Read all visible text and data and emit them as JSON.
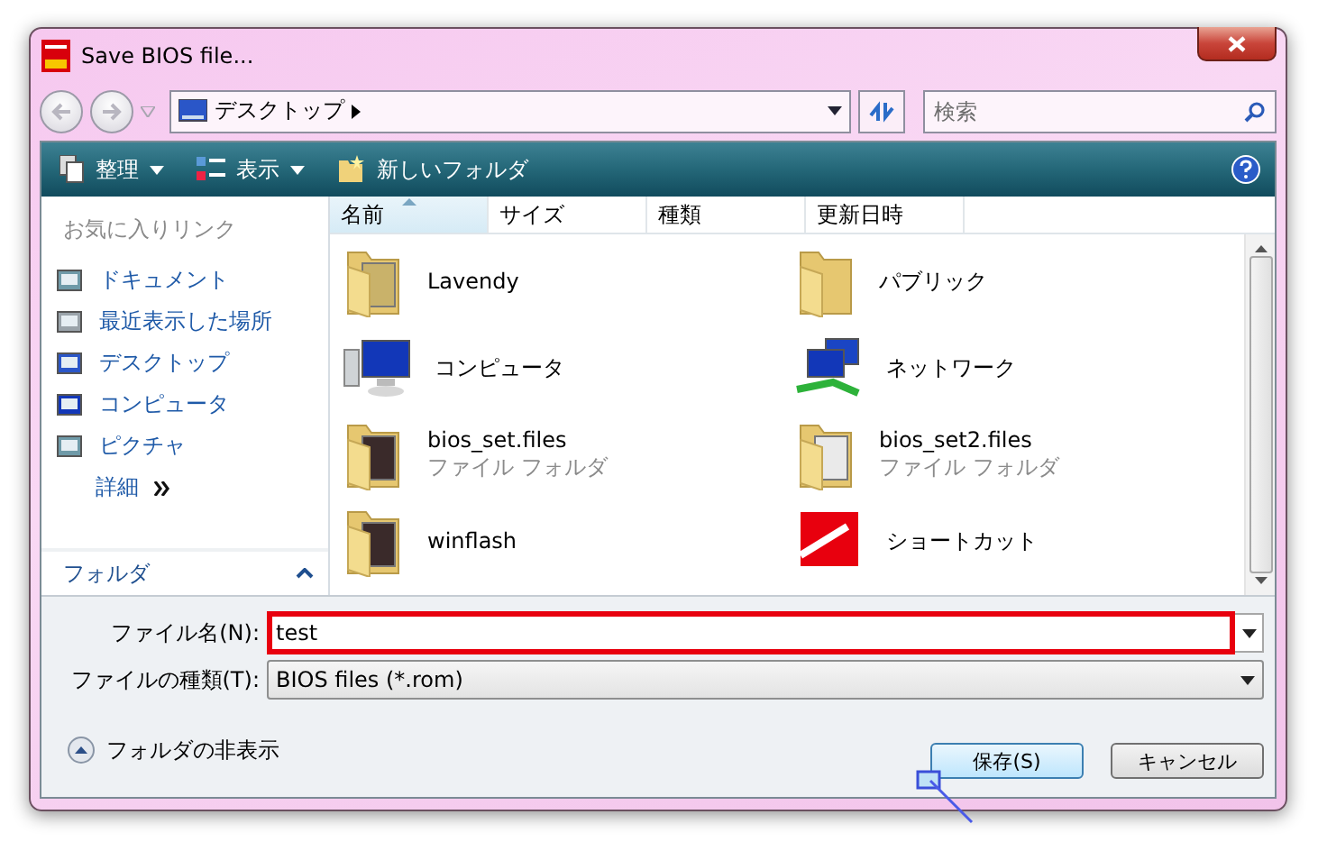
{
  "window": {
    "title": "Save BIOS file..."
  },
  "address": {
    "location": "デスクトップ"
  },
  "search": {
    "placeholder": "検索"
  },
  "toolbar": [
    {
      "label": "整理",
      "kind": "organize"
    },
    {
      "label": "表示",
      "kind": "views"
    },
    {
      "label": "新しいフォルダ",
      "kind": "newfolder"
    }
  ],
  "favorites": {
    "title": "お気に入りリンク",
    "items": [
      {
        "label": "ドキュメント",
        "kind": "documents"
      },
      {
        "label": "最近表示した場所",
        "kind": "recent"
      },
      {
        "label": "デスクトップ",
        "kind": "desktop"
      },
      {
        "label": "コンピュータ",
        "kind": "computer"
      },
      {
        "label": "ピクチャ",
        "kind": "pictures"
      }
    ],
    "more": "詳細"
  },
  "folders_pane": {
    "label": "フォルダ"
  },
  "columns": [
    {
      "label": "名前",
      "sorted": true
    },
    {
      "label": "サイズ",
      "sorted": false
    },
    {
      "label": "種類",
      "sorted": false
    },
    {
      "label": "更新日時",
      "sorted": false
    }
  ],
  "files": [
    {
      "name": "Lavendy",
      "kind": "userfolder"
    },
    {
      "name": "パブリック",
      "kind": "folder"
    },
    {
      "name": "コンピュータ",
      "kind": "computer"
    },
    {
      "name": "ネットワーク",
      "kind": "network"
    },
    {
      "name": "bios_set.files",
      "type": "ファイル フォルダ",
      "kind": "photofolder"
    },
    {
      "name": "bios_set2.files",
      "type": "ファイル フォルダ",
      "kind": "docfolder"
    },
    {
      "name": "winflash",
      "kind": "photofolder"
    },
    {
      "name": "ショートカット",
      "kind": "shortcut"
    }
  ],
  "filename": {
    "label": "ファイル名(N):",
    "value": "test"
  },
  "filetype": {
    "label": "ファイルの種類(T):",
    "value": "BIOS files (*.rom)"
  },
  "folder_toggle": {
    "label": "フォルダの非表示"
  },
  "buttons": [
    {
      "label": "保存(S)",
      "default": true
    },
    {
      "label": "キャンセル",
      "default": false
    }
  ]
}
